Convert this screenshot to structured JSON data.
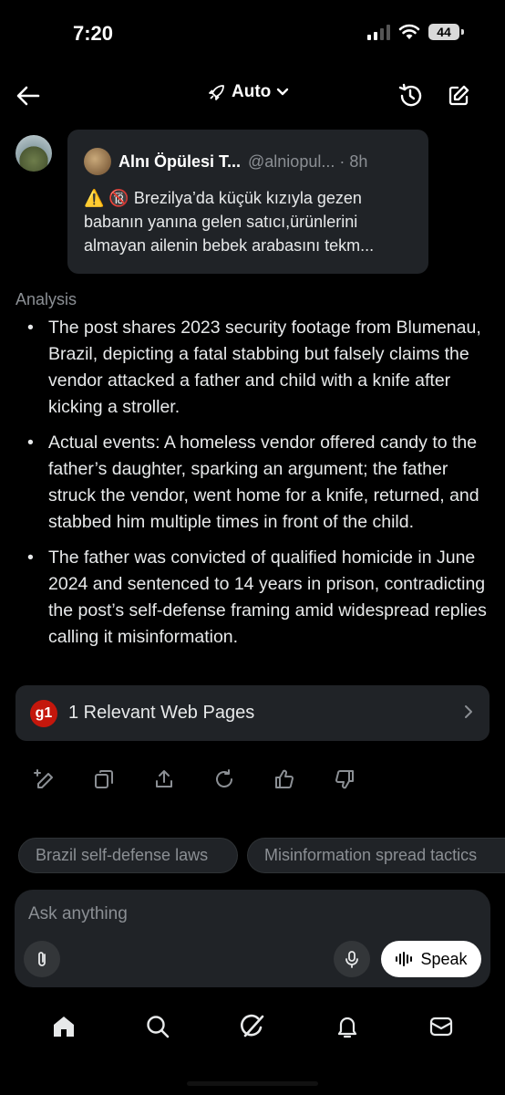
{
  "status": {
    "time": "7:20",
    "battery": "44"
  },
  "header": {
    "mode_label": "Auto"
  },
  "quoted_post": {
    "author_name": "Alnı Öpülesi T...",
    "handle_time": "@alniopul... · 8h",
    "text_lines": [
      "⚠️ 🔞 Brezilya’da küçük kızıyla gezen",
      "babanın yanına gelen satıcı,ürünlerini",
      "almayan ailenin bebek arabasını tekm..."
    ]
  },
  "analysis": {
    "label": "Analysis",
    "bullets": [
      "The post shares 2023 security footage from Blumenau, Brazil, depicting a fatal stabbing but falsely claims the vendor attacked a father and child with a knife after kicking a stroller.",
      "Actual events: A homeless vendor offered candy to the father’s daughter, sparking an argument; the father struck the vendor, went home for a knife, returned, and stabbed him multiple times in front of the child.",
      "The father was convicted of qualified homicide in June 2024 and sentenced to 14 years in prison, contradicting the post’s self-defense framing amid widespread replies calling it misinformation."
    ]
  },
  "web_pages": {
    "logo_text": "g1",
    "label": "1 Relevant Web Pages"
  },
  "suggestions": [
    "Brazil self-defense laws",
    "Misinformation spread tactics"
  ],
  "composer": {
    "placeholder": "Ask anything",
    "speak_label": "Speak"
  },
  "colors": {
    "background": "#000000",
    "surface": "#202327",
    "muted": "#8b8f94",
    "text": "#e7e9ea",
    "g1_red": "#c4170c"
  }
}
